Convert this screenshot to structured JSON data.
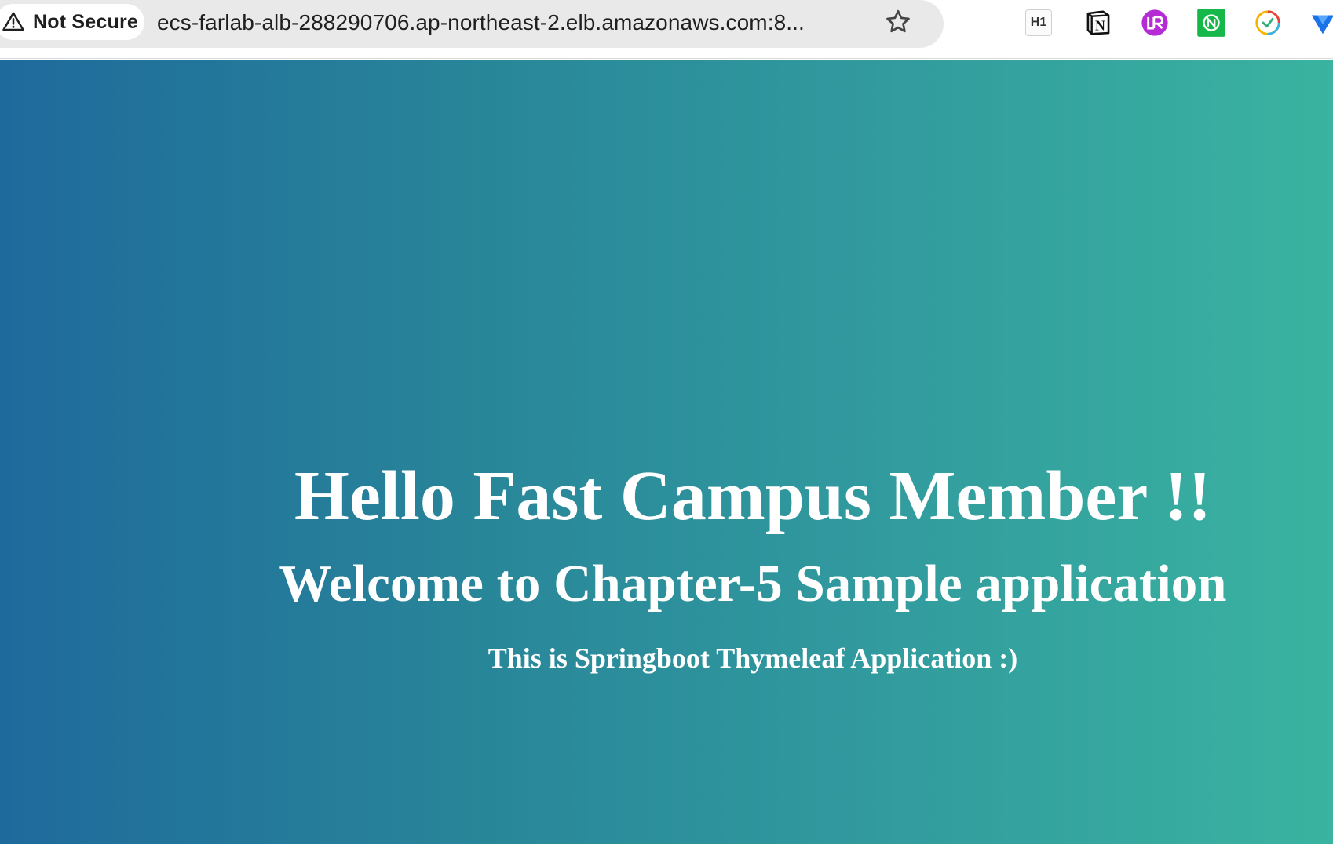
{
  "browser": {
    "security_label": "Not Secure",
    "url": "ecs-farlab-alb-288290706.ap-northeast-2.elb.amazonaws.com:8...",
    "extensions": [
      {
        "name": "h1-extension",
        "label": "H1"
      },
      {
        "name": "notion-extension",
        "label": "N"
      },
      {
        "name": "purple-extension"
      },
      {
        "name": "green-extension"
      },
      {
        "name": "clock-extension"
      },
      {
        "name": "blue-extension"
      }
    ]
  },
  "page": {
    "heading": "Hello Fast Campus Member !!",
    "subheading": "Welcome to Chapter-5 Sample application",
    "description": "This is Springboot Thymeleaf Application :)"
  },
  "colors": {
    "gradient_start": "#1f6a9c",
    "gradient_end": "#3ab3a0",
    "text": "#ffffff"
  }
}
